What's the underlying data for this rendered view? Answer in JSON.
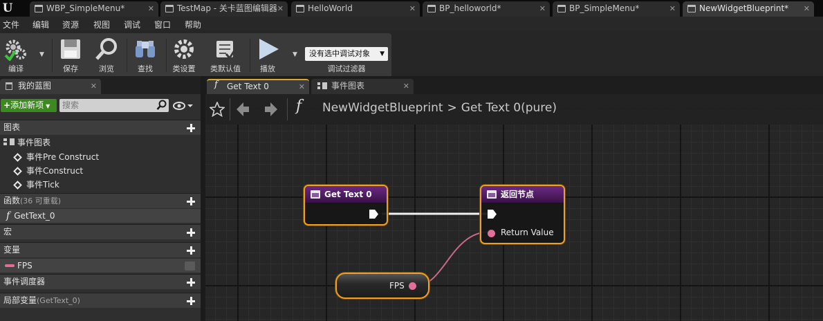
{
  "tabs": [
    "WBP_SimpleMenu*",
    "TestMap - 关卡蓝图编辑器",
    "HelloWorld",
    "BP_helloworld*",
    "BP_SimpleMenu*",
    "NewWidgetBlueprint*"
  ],
  "menu": [
    "文件",
    "编辑",
    "资源",
    "视图",
    "调试",
    "窗口",
    "帮助"
  ],
  "toolbar": {
    "compile": "编译",
    "save": "保存",
    "browse": "浏览",
    "find": "查找",
    "class_settings": "类设置",
    "class_defaults": "类默认值",
    "play": "播放",
    "debug_select": "没有选中调试对象",
    "debug_filter": "调试过滤器"
  },
  "my_blueprint": {
    "tab_title": "我的蓝图",
    "add_new": "添加新项",
    "search_placeholder": "搜索",
    "sections": {
      "graphs": "图表",
      "functions": "函数",
      "functions_note": "(36 可重载)",
      "macros": "宏",
      "variables": "变量",
      "event_dispatchers": "事件调度器",
      "local_variables": "局部变量",
      "local_variables_note": "(GetText_0)"
    },
    "event_graph": "事件图表",
    "events": [
      "事件Pre Construct",
      "事件Construct",
      "事件Tick"
    ],
    "function_item": "GetText_0",
    "variable_item": "FPS"
  },
  "graph_tabs": [
    "Get Text 0",
    "事件图表"
  ],
  "breadcrumb": {
    "blueprint": "NewWidgetBlueprint",
    "separator": ">",
    "function": "Get Text 0(pure)"
  },
  "nodes": {
    "entry_title": "Get Text 0",
    "return_title": "返回节点",
    "return_pin": "Return Value",
    "fps_pin": "FPS"
  },
  "colors": {
    "accent": "#f0a020",
    "node_header": "#5a1e70",
    "var_pin": "#e0709a",
    "add_button": "#3c8a1f"
  }
}
